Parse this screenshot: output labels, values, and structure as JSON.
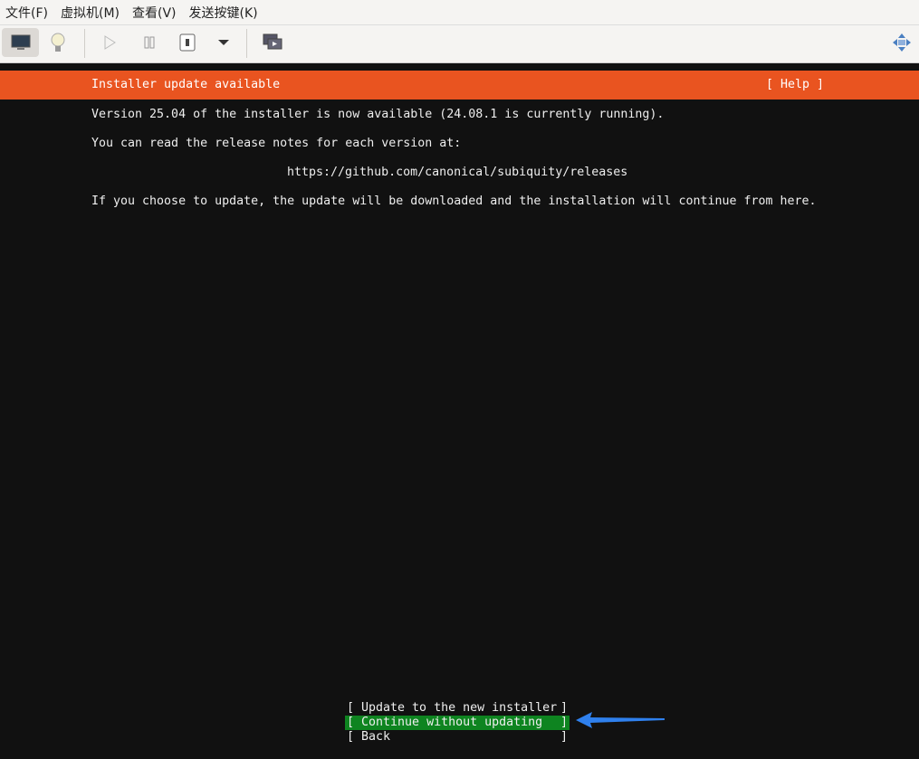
{
  "menu": [
    "文件(F)",
    "虚拟机(M)",
    "查看(V)",
    "发送按键(K)"
  ],
  "toolbar_icons": [
    "monitor-icon",
    "lightbulb-icon",
    "play-icon",
    "pause-icon",
    "power-icon",
    "dropdown-icon",
    "screens-icon",
    "fullscreen-move-icon"
  ],
  "banner": {
    "title": "Installer update available",
    "help": "[ Help ]"
  },
  "body": {
    "version_line": "Version 25.04 of the installer is now available (24.08.1 is currently running).",
    "notes_line": "You can read the release notes for each version at:",
    "url": "https://github.com/canonical/subiquity/releases",
    "update_line": "If you choose to update, the update will be downloaded and the installation will continue from here."
  },
  "buttons": [
    {
      "label": "Update to the new installer"
    },
    {
      "label": "Continue without updating",
      "selected": true
    },
    {
      "label": "Back"
    }
  ],
  "colors": {
    "accent": "#e95420",
    "selected": "#0e8420",
    "arrow": "#2f80ed"
  }
}
